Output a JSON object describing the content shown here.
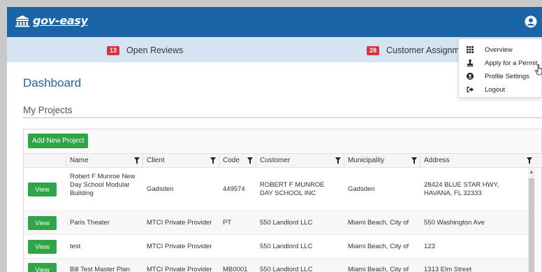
{
  "app": {
    "logo_text": "gov-easy"
  },
  "subbar": {
    "open_reviews": {
      "count": "13",
      "label": "Open Reviews"
    },
    "customer_assignments": {
      "count": "28",
      "label": "Customer Assignmer"
    }
  },
  "user_menu": {
    "items": [
      {
        "label": "Overview",
        "icon": "grid-icon"
      },
      {
        "label": "Apply for a Permit",
        "icon": "stamp-icon"
      },
      {
        "label": "Profile Settings",
        "icon": "user-circle-icon"
      },
      {
        "label": "Logout",
        "icon": "logout-icon"
      }
    ]
  },
  "page": {
    "title": "Dashboard",
    "section": "My Projects"
  },
  "grid": {
    "add_label": "Add New Project",
    "columns": [
      "Name",
      "Client",
      "Code",
      "Customer",
      "Municipality",
      "Address"
    ],
    "view_label": "View",
    "rows": [
      {
        "name": "Robert F Munroe New Day School Modular Building",
        "client": "Gadsden",
        "code": "449574",
        "customer": "ROBERT F MUNROE DAY SCHOOL INC",
        "municipality": "Gadsden",
        "address": "28424 BLUE STAR HWY, HAVANA, FL 32333"
      },
      {
        "name": "Paris Theater",
        "client": "MTCI Private Provider",
        "code": "PT",
        "customer": "550 Landlord LLC",
        "municipality": "Miami Beach, City of",
        "address": "550 Washington Ave"
      },
      {
        "name": "test",
        "client": "MTCI Private Provider",
        "code": "",
        "customer": "550 Landlord LLC",
        "municipality": "Miami Beach, City of",
        "address": "123"
      },
      {
        "name": "Bill Test Master Plan",
        "client": "MTCI Private Provider",
        "code": "MB0001",
        "customer": "550 Landlord LLC",
        "municipality": "Miami Beach, City of",
        "address": "1313 Elm Street"
      }
    ]
  },
  "colors": {
    "brand": "#1a64a8",
    "subbar": "#d5e4f3",
    "badge": "#d9333f",
    "action": "#2fa548"
  }
}
